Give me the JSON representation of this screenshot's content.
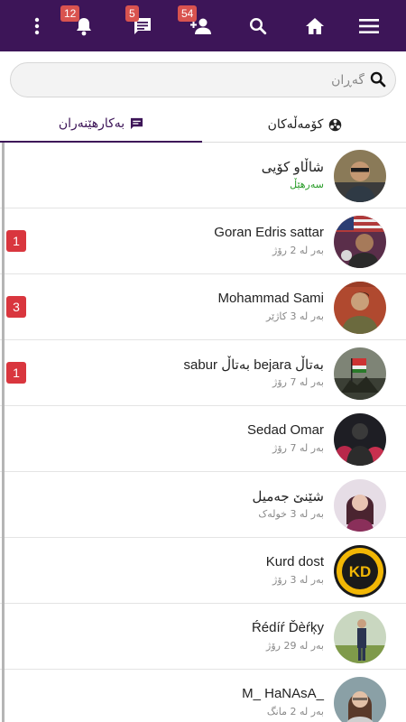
{
  "colors": {
    "topbar": "#3d1558",
    "badge": "#d9534f",
    "unread": "#d9363e",
    "online": "#2a9d2a"
  },
  "topbar": {
    "items": [
      {
        "name": "more-icon",
        "badge": null
      },
      {
        "name": "bell-icon",
        "badge": "12"
      },
      {
        "name": "chat-icon",
        "badge": "5"
      },
      {
        "name": "friends-icon",
        "badge": "54"
      },
      {
        "name": "search-icon",
        "badge": null
      },
      {
        "name": "home-icon",
        "badge": null
      },
      {
        "name": "menu-icon",
        "badge": null
      }
    ]
  },
  "search": {
    "placeholder": "گەڕان",
    "value": ""
  },
  "tabs": [
    {
      "label": "کۆمەڵەکان",
      "icon": "groups-icon",
      "active": false
    },
    {
      "label": "بەکارهێنەران",
      "icon": "chat-bubble-icon",
      "active": true
    }
  ],
  "conversations": [
    {
      "name": "شاڵاو کۆیی",
      "status": "سەرهێڵ",
      "online": true,
      "unread": null,
      "avatar": "avatar-shallaw"
    },
    {
      "name": "Goran Edris sattar",
      "status": "بەر لە 2 رۆژ",
      "online": false,
      "unread": "1",
      "avatar": "avatar-goran"
    },
    {
      "name": "Mohammad Sami",
      "status": "بەر لە 3 کاژێر",
      "online": false,
      "unread": "3",
      "avatar": "avatar-mohammad"
    },
    {
      "name": "sabur بەتاڵ bejara بەتاڵ",
      "status": "بەر لە 7 رۆژ",
      "online": false,
      "unread": "1",
      "avatar": "avatar-sabur"
    },
    {
      "name": "Sedad Omar",
      "status": "بەر لە 7 رۆژ",
      "online": false,
      "unread": null,
      "avatar": "avatar-sedad"
    },
    {
      "name": "شێنێ جەمیل",
      "status": "بەر لە 3 خولەک",
      "online": false,
      "unread": null,
      "avatar": "avatar-sheni"
    },
    {
      "name": "Kurd dost",
      "status": "بەر لە 3 رۆژ",
      "online": false,
      "unread": null,
      "avatar": "avatar-kurd-dost"
    },
    {
      "name": "Ŕédíŕ Ďèŕķy",
      "status": "بەر لە 29 رۆژ",
      "online": false,
      "unread": null,
      "avatar": "avatar-redir"
    },
    {
      "name": "M_ HaNAsA_",
      "status": "بەر لە 2 مانگ",
      "online": false,
      "unread": null,
      "avatar": "avatar-hanasa"
    }
  ]
}
